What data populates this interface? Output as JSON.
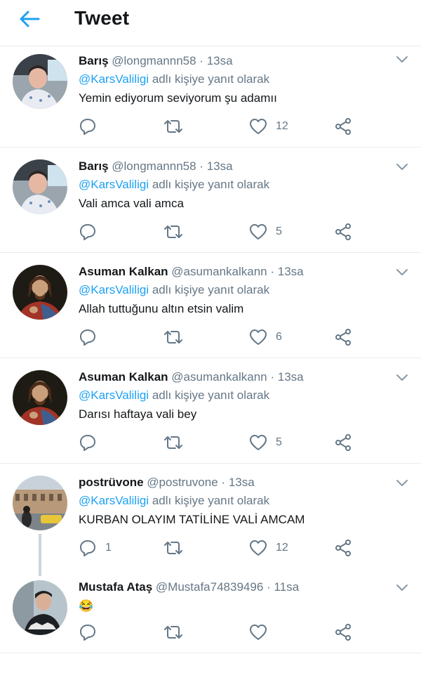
{
  "header": {
    "title": "Tweet",
    "accent": "#1da1f2"
  },
  "reply_prefix": "adlı kişiye yanıt olarak",
  "tweets": [
    {
      "name": "Barış",
      "handle": "@longmannn58",
      "time": "13sa",
      "mention": "@KarsValiligi",
      "text": "Yemin ediyorum seviyorum şu adamıı",
      "replies": "",
      "retweets": "",
      "likes": "12"
    },
    {
      "name": "Barış",
      "handle": "@longmannn58",
      "time": "13sa",
      "mention": "@KarsValiligi",
      "text": "Vali amca vali amca",
      "replies": "",
      "retweets": "",
      "likes": "5"
    },
    {
      "name": "Asuman Kalkan",
      "handle": "@asumankalkann",
      "time": "13sa",
      "mention": "@KarsValiligi",
      "text": "Allah tuttuğunu altın etsin valim",
      "replies": "",
      "retweets": "",
      "likes": "6"
    },
    {
      "name": "Asuman Kalkan",
      "handle": "@asumankalkann",
      "time": "13sa",
      "mention": "@KarsValiligi",
      "text": "Darısı haftaya vali bey",
      "replies": "",
      "retweets": "",
      "likes": "5"
    },
    {
      "name": "postrüvone",
      "handle": "@postruvone",
      "time": "13sa",
      "mention": "@KarsValiligi",
      "text": "KURBAN OLAYIM TATİLİNE VALİ AMCAM",
      "replies": "1",
      "retweets": "",
      "likes": "12"
    },
    {
      "name": "Mustafa Ataş",
      "handle": "@Mustafa74839496",
      "time": "11sa",
      "mention": "",
      "text": "😂",
      "replies": "",
      "retweets": "",
      "likes": ""
    }
  ],
  "separator": "·",
  "icons": [
    "back-arrow-icon",
    "chevron-down-icon",
    "reply-icon",
    "retweet-icon",
    "like-icon",
    "share-icon"
  ]
}
